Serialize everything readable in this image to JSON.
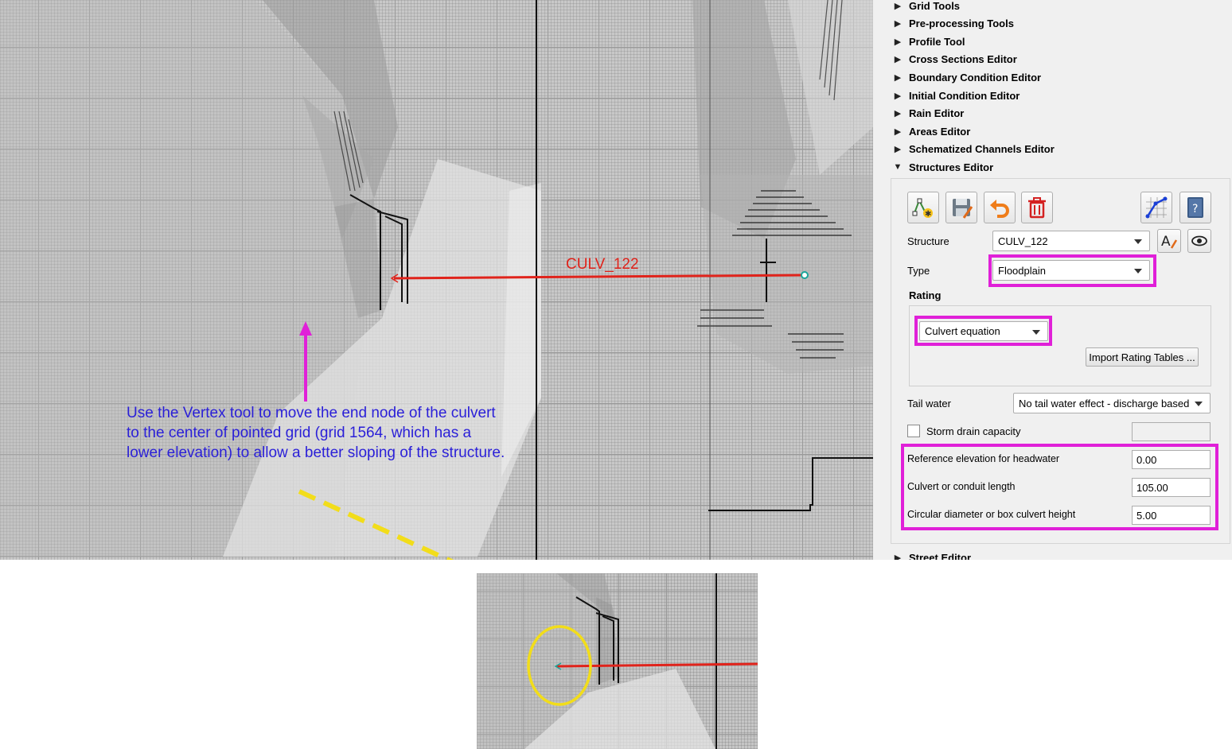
{
  "map": {
    "culvert_label": "CULV_122",
    "annotation": "Use the Vertex tool to move the end node of the culvert to the center of pointed grid (grid 1564, which has a lower elevation) to allow a better sloping of the structure.",
    "colors": {
      "culvert_line": "#e0231b",
      "annotation_text": "#2a1fd8",
      "arrow": "#e020d8",
      "dash_line": "#f2dd1a",
      "circle": "#f2dd1a"
    }
  },
  "panel": {
    "tree": [
      {
        "label": "Grid Tools",
        "expanded": false
      },
      {
        "label": "Pre-processing Tools",
        "expanded": false
      },
      {
        "label": "Profile Tool",
        "expanded": false
      },
      {
        "label": "Cross Sections Editor",
        "expanded": false
      },
      {
        "label": "Boundary Condition Editor",
        "expanded": false
      },
      {
        "label": "Initial Condition Editor",
        "expanded": false
      },
      {
        "label": "Rain Editor",
        "expanded": false
      },
      {
        "label": "Areas Editor",
        "expanded": false
      },
      {
        "label": "Schematized Channels Editor",
        "expanded": false
      },
      {
        "label": "Structures Editor",
        "expanded": true
      }
    ],
    "footer_item": {
      "label": "Street Editor",
      "expanded": false
    },
    "toolbar": {
      "icons": [
        "add-structure-icon",
        "save-icon",
        "undo-icon",
        "delete-icon",
        "plot-icon",
        "help-icon"
      ]
    },
    "structure": {
      "label": "Structure",
      "value": "CULV_122"
    },
    "type": {
      "label": "Type",
      "value": "Floodplain"
    },
    "rating": {
      "label": "Rating",
      "value": "Culvert equation",
      "import_button": "Import Rating Tables ..."
    },
    "tailwater": {
      "label": "Tail water",
      "value": "No tail water effect - discharge based c"
    },
    "storm_drain": {
      "label": "Storm drain capacity",
      "checked": false,
      "value": ""
    },
    "params": [
      {
        "label": "Reference elevation for headwater",
        "value": "0.00"
      },
      {
        "label": "Culvert or conduit length",
        "value": "105.00"
      },
      {
        "label": "Circular diameter or box culvert height",
        "value": "5.00"
      }
    ],
    "highlight_color": "#e020d8"
  }
}
